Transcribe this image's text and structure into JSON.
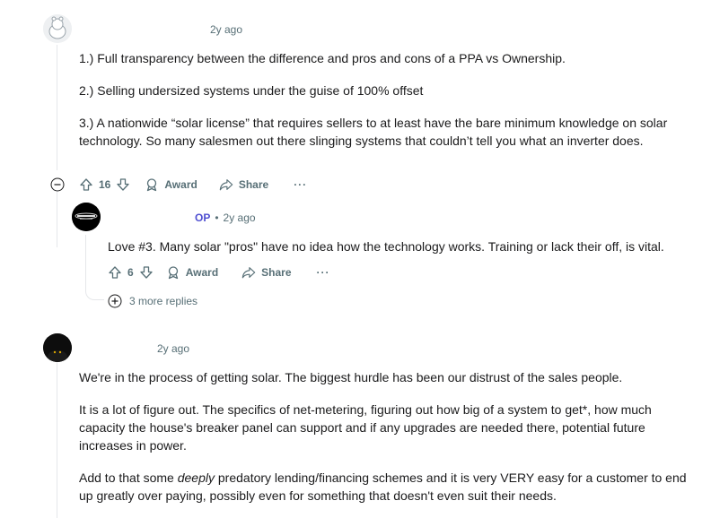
{
  "comment1": {
    "time": "2y ago",
    "paragraphs": [
      "1.) Full transparency between the difference and pros and cons of a PPA vs Ownership.",
      "2.) Selling undersized systems under the guise of 100% offset",
      "3.) A nationwide “solar license” that requires sellers to at least have the bare minimum knowledge on solar technology. So many salesmen out there slinging systems that couldn’t tell you what an inverter does."
    ],
    "votes": "16",
    "award": "Award",
    "share": "Share",
    "more": "···"
  },
  "reply1": {
    "badge": "OP",
    "sep": "•",
    "time": "2y ago",
    "text": "Love #3. Many solar \"pros\" have no idea how the technology works. Training or lack their off, is vital.",
    "votes": "6",
    "award": "Award",
    "share": "Share",
    "more": "···",
    "more_replies": "3 more replies"
  },
  "comment2": {
    "time": "2y ago",
    "p1": "We're in the process of getting solar. The biggest hurdle has been our distrust of the sales people.",
    "p2": "It is a lot of figure out. The specifics of net-metering, figuring out how big of a system to get*, how much capacity the house's breaker panel can support and if any upgrades are needed there, potential future increases in power.",
    "p3_pre": "Add to that some ",
    "p3_em": "deeply",
    "p3_post": " predatory lending/financing schemes and it is very VERY easy for a customer to end up greatly over paying, possibly even for something that doesn't even suit their needs."
  }
}
